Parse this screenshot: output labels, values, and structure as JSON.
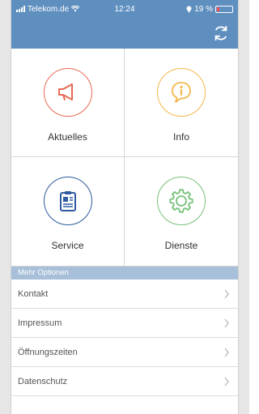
{
  "status": {
    "carrier": "Telekom.de",
    "time": "12:24",
    "battery": "19 %",
    "battery_level": 0.19
  },
  "navbar": {
    "refresh_icon": "refresh-icon"
  },
  "tiles": [
    {
      "label": "Aktuelles",
      "icon": "megaphone-icon",
      "color": "#e86a55"
    },
    {
      "label": "Info",
      "icon": "info-icon",
      "color": "#f2b84b"
    },
    {
      "label": "Service",
      "icon": "clipboard-icon",
      "color": "#2f5aa0"
    },
    {
      "label": "Dienste",
      "icon": "gear-icon",
      "color": "#77c17b"
    }
  ],
  "section": {
    "title": "Mehr Optionen"
  },
  "list": [
    {
      "label": "Kontakt"
    },
    {
      "label": "Impressum"
    },
    {
      "label": "Öffnungszeiten"
    },
    {
      "label": "Datenschutz"
    }
  ],
  "colors": {
    "bar": "#5f8fbf",
    "section": "#a7bfd9"
  }
}
